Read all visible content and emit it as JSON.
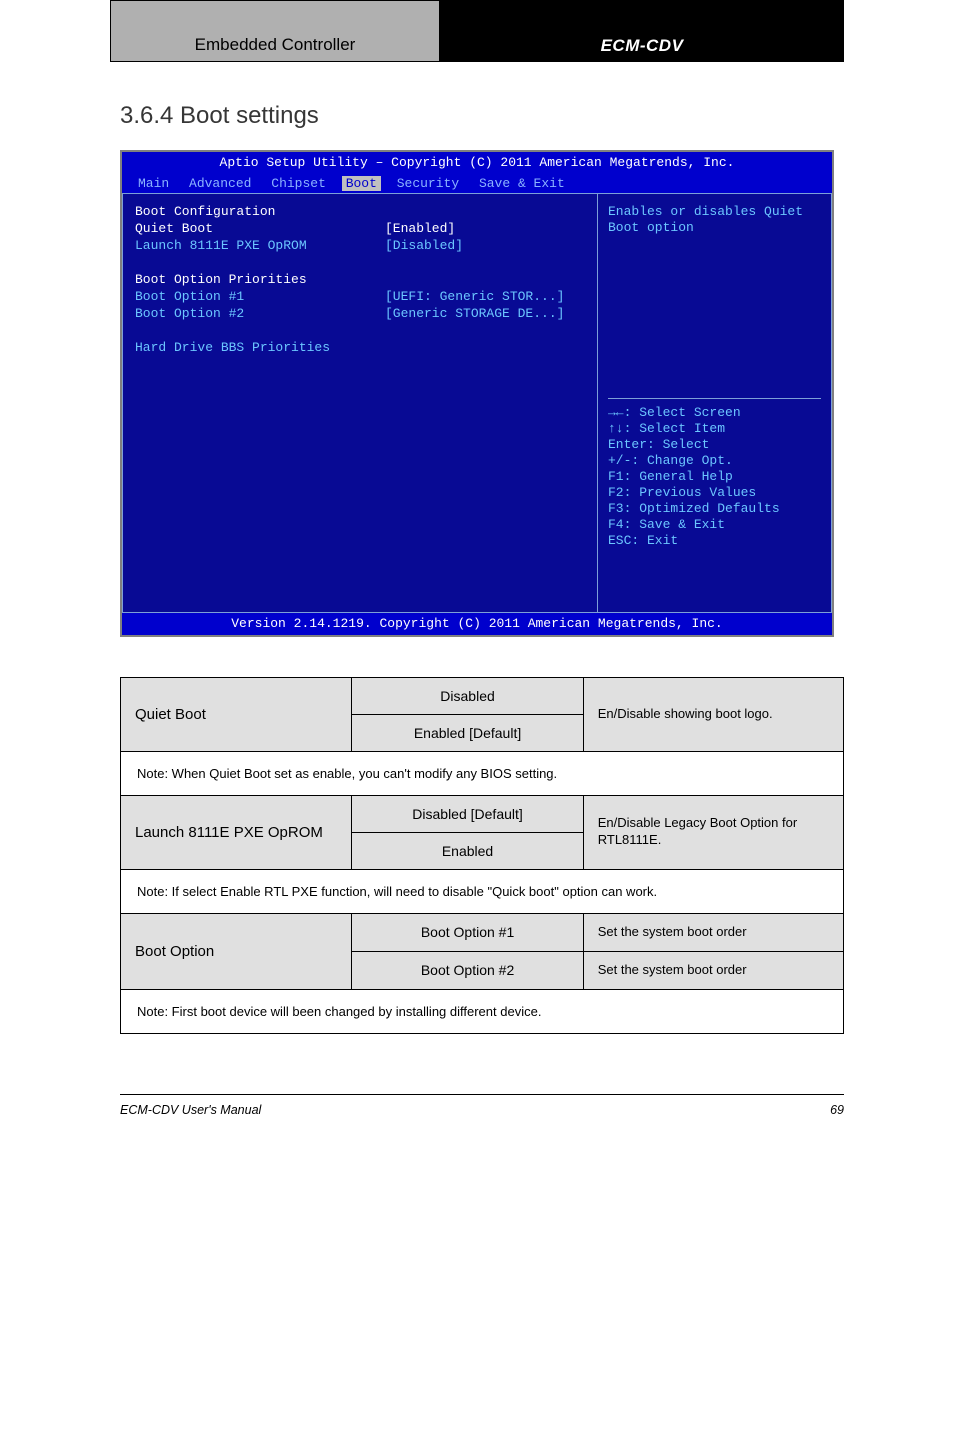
{
  "header": {
    "left": "Embedded Controller",
    "right": "ECM-CDV"
  },
  "section_title": "3.6.4 Boot settings",
  "bios": {
    "title": "Aptio Setup Utility – Copyright (C) 2011 American Megatrends, Inc.",
    "tabs": [
      "Main",
      "Advanced",
      "Chipset",
      "Boot",
      "Security",
      "Save & Exit"
    ],
    "selected_tab": "Boot",
    "left_items": [
      {
        "label": "Boot Configuration",
        "value": "",
        "lcolor": "wht",
        "vcolor": ""
      },
      {
        "label": "Quiet Boot",
        "value": "[Enabled]",
        "lcolor": "lbl-white",
        "vcolor": "wht"
      },
      {
        "label": "Launch 8111E PXE OpROM",
        "value": "[Disabled]",
        "lcolor": "blu",
        "vcolor": "blu"
      },
      {
        "label": "",
        "value": "",
        "lcolor": "",
        "vcolor": ""
      },
      {
        "label": "Boot Option Priorities",
        "value": "",
        "lcolor": "wht",
        "vcolor": ""
      },
      {
        "label": "Boot Option #1",
        "value": "[UEFI: Generic STOR...]",
        "lcolor": "blu",
        "vcolor": "blu"
      },
      {
        "label": "Boot Option #2",
        "value": "[Generic STORAGE DE...]",
        "lcolor": "blu",
        "vcolor": "blu"
      },
      {
        "label": "",
        "value": "",
        "lcolor": "",
        "vcolor": ""
      },
      {
        "label": "Hard Drive BBS Priorities",
        "value": "",
        "lcolor": "blu",
        "vcolor": ""
      }
    ],
    "help_desc": "Enables or disables Quiet Boot option",
    "help_keys": [
      "→←: Select Screen",
      "↑↓: Select Item",
      "Enter: Select",
      "+/-: Change Opt.",
      "F1: General Help",
      "F2: Previous Values",
      "F3: Optimized Defaults",
      "F4: Save & Exit",
      "ESC: Exit"
    ],
    "footer": "Version 2.14.1219. Copyright (C) 2011 American Megatrends, Inc."
  },
  "table": {
    "rows": [
      {
        "name": "Quiet Boot",
        "opt1": "Disabled",
        "opt2": "Enabled [Default]",
        "desc": "En/Disable showing boot logo."
      },
      {
        "name": "Launch 8111E PXE OpROM",
        "opt1": "Disabled [Default]",
        "opt2": "Enabled",
        "desc": "En/Disable Legacy Boot Option for RTL8111E."
      }
    ],
    "boot_opts": {
      "name": "Boot Option",
      "opt1": "Boot Option #1",
      "opt2": "Boot Option #2",
      "desc1": "Set the system boot order",
      "desc2": "Set the system boot order"
    },
    "notes": {
      "n1": "Note: When Quiet Boot set as enable, you can't modify any BIOS setting.",
      "n2": "Note: If select Enable RTL PXE function, will need to disable \"Quick boot\" option can work.",
      "n3": "Note: First boot device will been changed by installing different device."
    }
  },
  "footer": {
    "left": "ECM-CDV User's Manual",
    "right": "69"
  }
}
